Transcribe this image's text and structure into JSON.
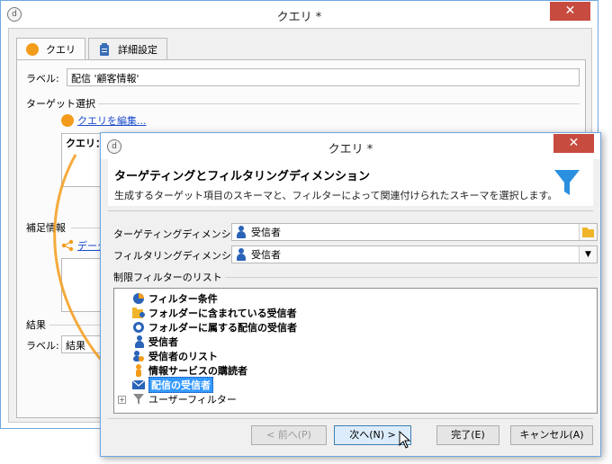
{
  "outer": {
    "title": "クエリ *",
    "close_glyph": "✕",
    "tabs": [
      {
        "label": "クエリ"
      },
      {
        "label": "詳細設定"
      }
    ],
    "label_caption": "ラベル:",
    "label_value": "配信 '顧客情報'",
    "target_section": "ターゲット選択",
    "edit_query_link": "クエリを編集...",
    "query_prefix": "クエリ：",
    "additional_section": "補足情報",
    "data_link_partial": "データ",
    "result_section": "結果",
    "result_label_caption": "ラベル:",
    "result_label_value": "結果"
  },
  "dialog": {
    "title": "クエリ *",
    "close_glyph": "✕",
    "header_title": "ターゲティングとフィルタリングディメンション",
    "header_subtitle": "生成するターゲット項目のスキーマと、フィルターによって関連付けられたスキーマを選択します。",
    "targeting_label": "ターゲティングディメンション:",
    "targeting_value": "受信者",
    "filtering_label": "フィルタリングディメンション:",
    "filtering_value": "受信者",
    "filter_list_section": "制限フィルターのリスト",
    "filter_items": [
      {
        "label": "フィルター条件",
        "icon": "filter-conditions-icon"
      },
      {
        "label": "フォルダーに含まれている受信者",
        "icon": "folder-recipients-icon"
      },
      {
        "label": "フォルダーに属する配信の受信者",
        "icon": "folder-delivery-recipients-icon"
      },
      {
        "label": "受信者",
        "icon": "recipient-icon"
      },
      {
        "label": "受信者のリスト",
        "icon": "recipient-list-icon"
      },
      {
        "label": "情報サービスの購読者",
        "icon": "subscriber-icon"
      },
      {
        "label": "配信の受信者",
        "icon": "delivery-recipients-icon",
        "selected": true
      },
      {
        "label": "ユーザーフィルター",
        "icon": "user-filter-icon",
        "expandable": true
      }
    ],
    "buttons": {
      "prev": "< 前へ(P)",
      "next": "次へ(N) >",
      "finish": "完了(E)",
      "cancel": "キャンセル(A)"
    }
  },
  "colors": {
    "accent_orange": "#f39c1b",
    "close_red": "#c74b3f",
    "selection_blue": "#3399ff",
    "funnel_blue": "#2b8fe0"
  }
}
